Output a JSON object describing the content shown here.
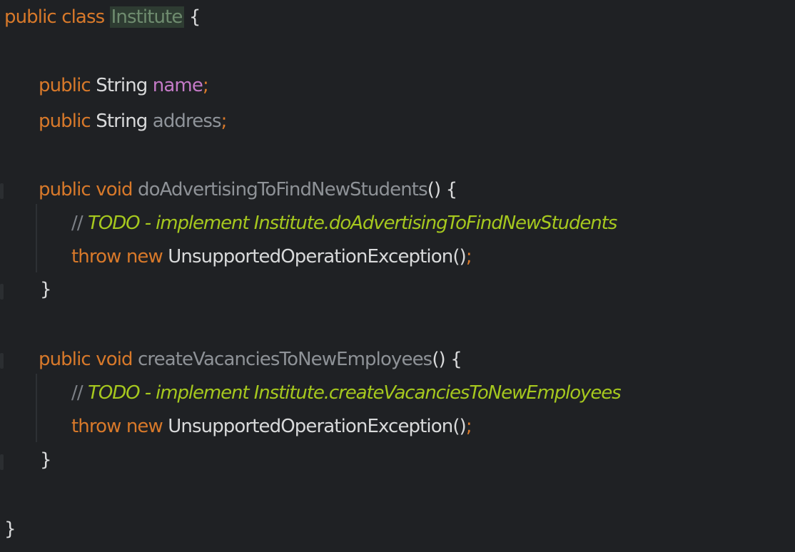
{
  "editor": {
    "line1": {
      "kw_public": "public",
      "kw_class": "class",
      "class_name": "Institute",
      "brace": "{"
    },
    "line2": {
      "kw_public": "public",
      "type": "String",
      "name": "name",
      "semi": ";"
    },
    "line3": {
      "kw_public": "public",
      "type": "String",
      "name": "address",
      "semi": ";"
    },
    "line4": {
      "kw_public": "public",
      "kw_void": "void",
      "method": "doAdvertisingToFindNewStudents",
      "parens": "()",
      "brace": "{"
    },
    "line5": {
      "slashes": "//",
      "todo": "TODO - implement Institute.doAdvertisingToFindNewStudents"
    },
    "line6": {
      "kw_throw": "throw",
      "kw_new": "new",
      "exception": "UnsupportedOperationException",
      "call": "()",
      "semi": ";"
    },
    "line7": {
      "brace": "}"
    },
    "line8": {
      "kw_public": "public",
      "kw_void": "void",
      "method": "createVacanciesToNewEmployees",
      "parens": "()",
      "brace": "{"
    },
    "line9": {
      "slashes": "//",
      "todo": "TODO - implement Institute.createVacanciesToNewEmployees"
    },
    "line10": {
      "kw_throw": "throw",
      "kw_new": "new",
      "exception": "UnsupportedOperationException",
      "call": "()",
      "semi": ";"
    },
    "line11": {
      "brace": "}"
    },
    "line12": {
      "brace": "}"
    }
  }
}
